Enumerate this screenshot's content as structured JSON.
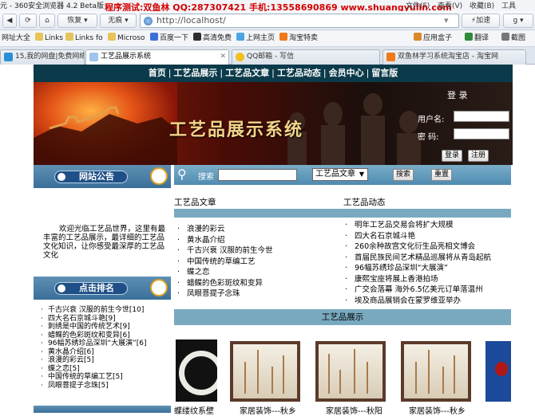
{
  "browser": {
    "app_title": "元 - 360安全浏览器 4.2 Beta版",
    "promo": "程序测试:双鱼林 QQ:287307421 手机:13558690869 www.shuangyulin.com",
    "menu": [
      "文件(F)",
      "查看(V)",
      "收藏(B)",
      "工具"
    ],
    "nav": {
      "restore_label": "恢复",
      "no_image_label": "无痕",
      "speed_label": "加速"
    },
    "url": "http://localhost/",
    "bookmarks": [
      "网址大全",
      "Links",
      "Links fo",
      "Microso",
      "百度一下",
      "高清免费",
      "上网主页",
      "淘宝特卖",
      "应用盒子",
      "翻译",
      "截图"
    ],
    "tabs": [
      {
        "label": "15,我的网盘|免费网络...",
        "active": false
      },
      {
        "label": "工艺品展示系统",
        "active": true
      },
      {
        "label": "QQ邮箱 - 写信",
        "active": false
      },
      {
        "label": "双鱼林学习系统淘宝店 - 淘宝网",
        "active": false
      }
    ]
  },
  "site": {
    "nav": [
      "首页",
      "工艺品展示",
      "工艺品文章",
      "工艺品动态",
      "会员中心",
      "留言版"
    ],
    "banner_title": "工艺品展示系统",
    "login": {
      "title": "登 录",
      "username_label": "用户名:",
      "password_label": "密  码:",
      "login_btn": "登录",
      "register_btn": "注册"
    },
    "left": {
      "notice_title": "网站公告",
      "notice_text": "欢迎光临工艺品世界，这里有最丰富的工艺品展示，最详细的工艺品文化知识，让你感受最深厚的工艺品文化",
      "rank_title": "点击排名",
      "rank_items": [
        "千古兴衰 汉服的前生今世[10]",
        "四大名石京城斗艳[9]",
        "刺绣是中国的传统艺术[9]",
        "蜡鲽的色彩斑纹和变异[6]",
        "96幅苏绣珍品深圳“大展演”[6]",
        "黄水晶介绍[6]",
        "浪漫的彩云[5]",
        "蝶之恋[5]",
        "中国传统的草编工艺[5]",
        "凤眼菩提子念珠[5]"
      ]
    },
    "search": {
      "label": "搜索",
      "select_value": "工艺品文章",
      "search_btn": "搜索",
      "reset_btn": "重置"
    },
    "articles": {
      "title": "工艺品文章",
      "items": [
        "浪漫的彩云",
        "黄水晶介绍",
        "千古兴衰 汉服的前生今世",
        "中国传统的草编工艺",
        "蝶之恋",
        "蜡鲽的色彩斑纹和变异",
        "凤眼菩提子念珠"
      ]
    },
    "news": {
      "title": "工艺品动态",
      "items": [
        "明年工艺品交易会将扩大规模",
        "四大名石京城斗艳",
        "260余种故宫文化衍生品亮相文博会",
        "首届民族民间艺术精品巡展将从青岛起航",
        "96幅苏绣珍品深圳“大展演”",
        "康熙宝座将展上香港拍场",
        "广交会落幕 海外6.5亿美元订单落温州",
        "埃及商品展销会在蒙罗维亚举办"
      ]
    },
    "showcase": {
      "title": "工艺品展示",
      "captions": [
        "蝶缕纹系壁",
        "家居装饰---秋乡",
        "家居装饰---秋阳",
        "家居装饰---秋乡"
      ]
    }
  }
}
